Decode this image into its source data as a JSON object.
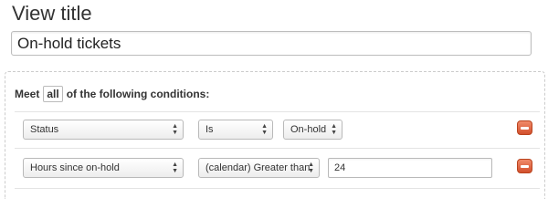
{
  "view_title": {
    "label": "View title",
    "value": "On-hold tickets"
  },
  "conditions": {
    "prefix": "Meet",
    "match_mode": "all",
    "suffix": "of the following conditions:",
    "rows": [
      {
        "field": "Status",
        "operator": "Is",
        "value": "On-hold",
        "value_type": "select"
      },
      {
        "field": "Hours since on-hold",
        "operator": "(calendar) Greater than",
        "value": "24",
        "value_type": "text"
      }
    ]
  },
  "colors": {
    "remove_button": "#d9532f"
  },
  "icons": {
    "select_arrows": "updown-arrows-icon",
    "remove": "minus-icon"
  }
}
